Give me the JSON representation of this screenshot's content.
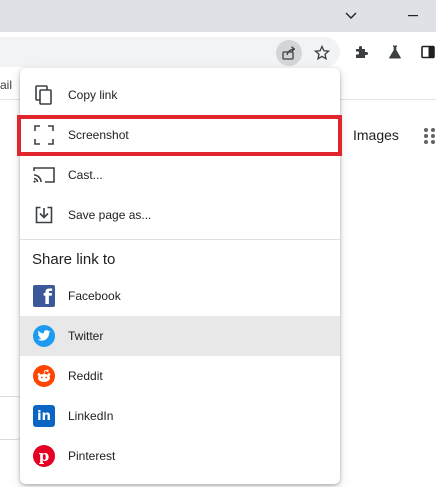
{
  "browser": {
    "bookmarks_bar": {
      "partial_text": "ail"
    },
    "page": {
      "images_link": "Images"
    },
    "icons": {
      "tab_search": "chevron-down-icon",
      "minimize": "minimize-icon",
      "share": "share-icon",
      "bookmark": "star-icon",
      "extensions": "puzzle-icon",
      "labs": "flask-icon",
      "side_panel": "side-panel-icon",
      "apps": "apps-grid-icon"
    }
  },
  "share_menu": {
    "items": [
      {
        "label": "Copy link",
        "icon": "copy-icon"
      },
      {
        "label": "Screenshot",
        "icon": "screenshot-icon"
      },
      {
        "label": "Cast...",
        "icon": "cast-icon"
      },
      {
        "label": "Save page as...",
        "icon": "download-icon"
      }
    ],
    "share_title": "Share link to",
    "share_targets": [
      {
        "label": "Facebook",
        "icon": "facebook-icon",
        "color": "#3b5998"
      },
      {
        "label": "Twitter",
        "icon": "twitter-icon",
        "color": "#1d9bf0",
        "hovered": true
      },
      {
        "label": "Reddit",
        "icon": "reddit-icon",
        "color": "#ff4500"
      },
      {
        "label": "LinkedIn",
        "icon": "linkedin-icon",
        "color": "#0a66c2"
      },
      {
        "label": "Pinterest",
        "icon": "pinterest-icon",
        "color": "#e60023"
      }
    ]
  },
  "annotation": {
    "color": "#e0252c",
    "target": "Screenshot"
  }
}
